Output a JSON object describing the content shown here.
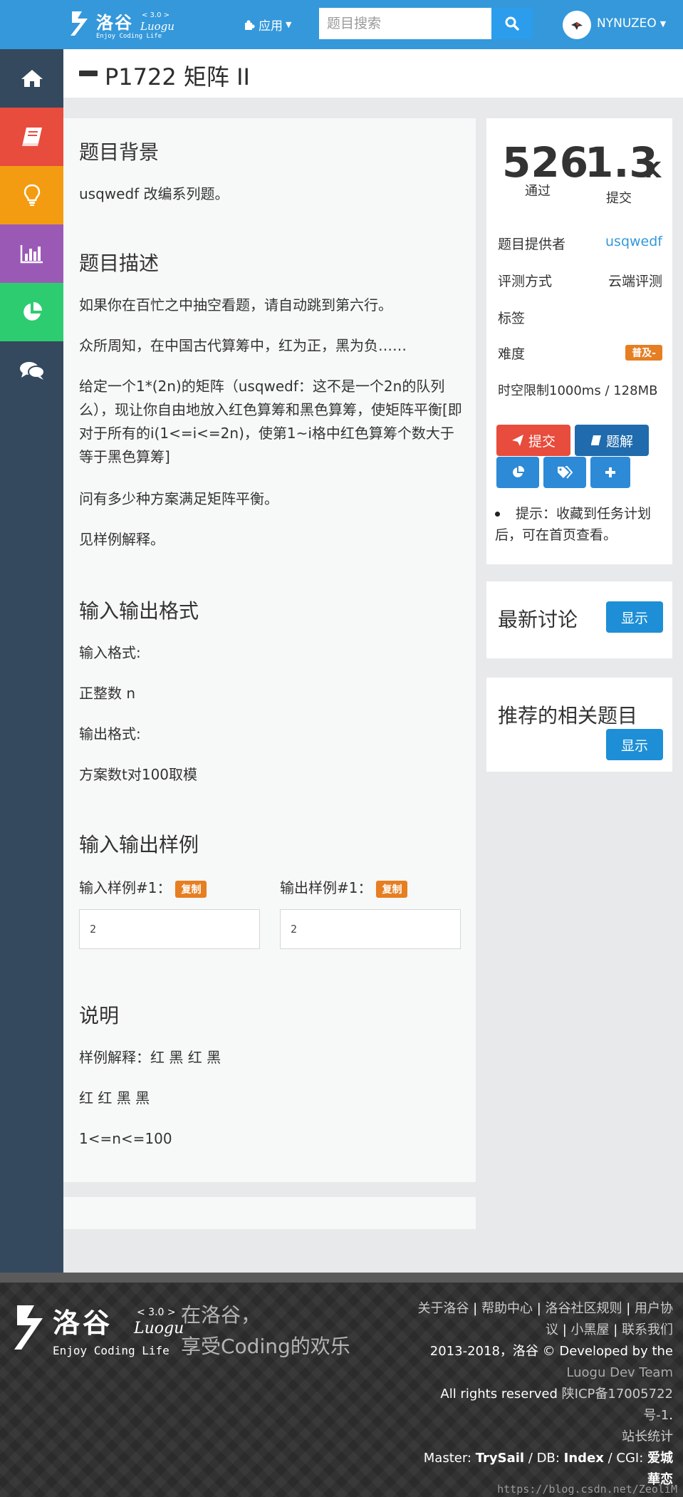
{
  "navbar": {
    "brand": {
      "cn": "洛谷",
      "version": "< 3.0 >",
      "name": "Luogu",
      "tagline": "Enjoy Coding Life"
    },
    "apps_label": "应用",
    "search_placeholder": "题目搜索",
    "username": "NYNUZEO"
  },
  "sidebar": {
    "items": [
      {
        "icon": "home-icon",
        "color": "#34495e"
      },
      {
        "icon": "book-icon",
        "color": "#e74c3c"
      },
      {
        "icon": "lightbulb-icon",
        "color": "#f39c12"
      },
      {
        "icon": "bar-chart-icon",
        "color": "#9b59b6"
      },
      {
        "icon": "pie-chart-icon",
        "color": "#2ecc71"
      },
      {
        "icon": "comments-icon",
        "color": "#34495e"
      }
    ]
  },
  "problem": {
    "title": "P1722 矩阵 II",
    "background_heading": "题目背景",
    "background_text": "usqwedf 改编系列题。",
    "description_heading": "题目描述",
    "description": [
      "如果你在百忙之中抽空看题，请自动跳到第六行。",
      "众所周知，在中国古代算筹中，红为正，黑为负……",
      "给定一个1*(2n)的矩阵（usqwedf：这不是一个2n的队列么），现让你自由地放入红色算筹和黑色算筹，使矩阵平衡[即对于所有的i(1<=i<=2n)，使第1~i格中红色算筹个数大于等于黑色算筹]",
      "问有多少种方案满足矩阵平衡。",
      "见样例解释。"
    ],
    "io_heading": "输入输出格式",
    "input_format_label": "输入格式:",
    "input_format": "正整数 n",
    "output_format_label": "输出格式:",
    "output_format": "方案数t对100取模",
    "samples_heading": "输入输出样例",
    "input_sample_label": "输入样例#1：",
    "output_sample_label": "输出样例#1：",
    "copy_label": "复制",
    "input_sample": "2",
    "output_sample": "2",
    "notes_heading": "说明",
    "notes": [
      "样例解释：红 黑 红 黑",
      "红 红 黑 黑",
      "1<=n<=100"
    ]
  },
  "stats": {
    "accepted": "526",
    "accepted_label": "通过",
    "submitted": "1.3",
    "submitted_unit": "K",
    "submitted_label": "提交",
    "provider_label": "题目提供者",
    "provider": "usqwedf",
    "judge_label": "评测方式",
    "judge": "云端评测",
    "tags_label": "标签",
    "difficulty_label": "难度",
    "difficulty": "普及-",
    "limits": "时空限制1000ms / 128MB",
    "submit_btn": "提交",
    "solution_btn": "题解",
    "hint": "提示：收藏到任务计划后，可在首页查看。"
  },
  "discussion": {
    "heading": "最新讨论",
    "show": "显示"
  },
  "related": {
    "heading": "推荐的相关题目",
    "show": "显示"
  },
  "footer": {
    "brand": {
      "cn": "洛谷",
      "version": "< 3.0 >",
      "name": "Luogu",
      "tagline": "Enjoy Coding Life"
    },
    "slogan_1": "在洛谷，",
    "slogan_2": "享受Coding的欢乐",
    "link_about": "关于洛谷",
    "link_help": "帮助中心",
    "link_rules": "洛谷社区规则",
    "link_agreement": "用户协议",
    "link_blackroom": "小黑屋",
    "link_contact": "联系我们",
    "copyright": "2013-2018，洛谷 © Developed by the",
    "team": "Luogu Dev Team",
    "rights": "All rights reserved",
    "icp": "陕ICP备17005722号-1",
    "stats_link": "站长统计",
    "master_label": "Master:",
    "master": "TrySail",
    "db_label": "DB:",
    "db": "Index",
    "cgi_label": "CGI:",
    "cgi": "爱城華恋"
  },
  "watermark": "https://blog.csdn.net/ZeoliM"
}
